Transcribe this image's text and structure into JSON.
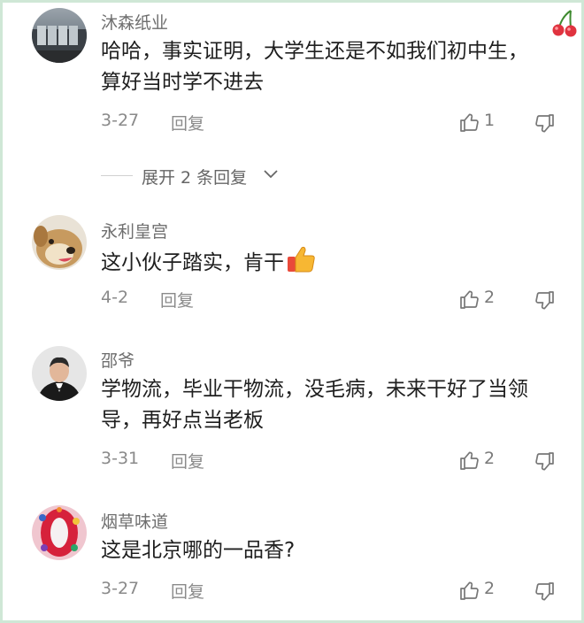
{
  "comments": [
    {
      "username": "沐森纸业",
      "text": "哈哈，事实证明，大学生还是不如我们初中生，算好当时学不进去",
      "date": "3-27",
      "reply": "回复",
      "likes": "1"
    },
    {
      "username": "永利皇宫",
      "text": "这小伙子踏实，肯干",
      "date": "4-2",
      "reply": "回复",
      "likes": "2"
    },
    {
      "username": "邵爷",
      "text": "学物流，毕业干物流，没毛病，未来干好了当领导，再好点当老板",
      "date": "3-31",
      "reply": "回复",
      "likes": "2"
    },
    {
      "username": "烟草味道",
      "text": "这是北京哪的一品香?",
      "date": "3-27",
      "reply": "回复",
      "likes": "2"
    }
  ],
  "expand": {
    "label": "展开 2 条回复"
  },
  "icons": {
    "like": "thumbs-up-outline-icon",
    "dislike": "thumbs-down-outline-icon",
    "cherry": "cherry-icon",
    "thumb_emoji": "thumbs-up-emoji",
    "chevron": "chevron-down-icon"
  },
  "colors": {
    "border": "#cfe7d6",
    "username": "#6e6e6e",
    "text": "#1f1f1f",
    "meta": "#8a8a8a"
  }
}
